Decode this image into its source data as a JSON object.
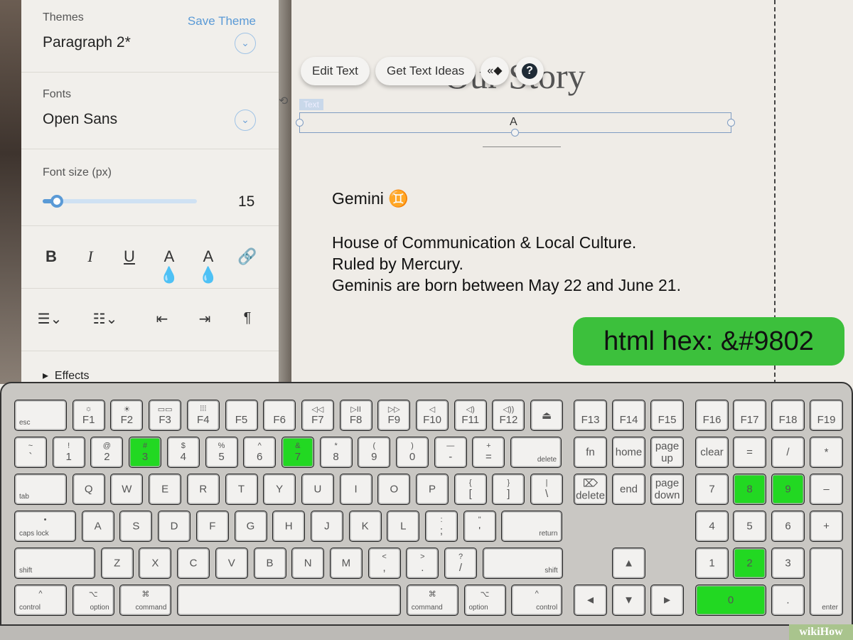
{
  "panel": {
    "themes_label": "Themes",
    "save_theme": "Save Theme",
    "theme_value": "Paragraph 2*",
    "fonts_label": "Fonts",
    "font_value": "Open Sans",
    "size_label": "Font size (px)",
    "size_value": "15",
    "size_fraction": 0.09,
    "effects": "Effects"
  },
  "toolbar": {
    "edit_text": "Edit Text",
    "get_text_ideas": "Get Text Ideas",
    "help": "?"
  },
  "canvas": {
    "title": "Our Story",
    "tag": "Text",
    "anchor": "A",
    "heading": "Gemini ♊",
    "line1": "House of Communication & Local Culture.",
    "line2": "Ruled by Mercury.",
    "line3": "Geminis are born between May 22 and June 21."
  },
  "badge": {
    "text": "html hex: &#9802",
    "color": "#3cc03c"
  },
  "highlight_color": "#22d822",
  "keyboard": {
    "rows": [
      [
        {
          "sl": "esc"
        },
        {
          "t": "☼",
          "b": "F1"
        },
        {
          "t": "☀",
          "b": "F2"
        },
        {
          "t": "▭▭",
          "b": "F3"
        },
        {
          "t": "⁞⁞⁞",
          "b": "F4"
        },
        {
          "b": "F5"
        },
        {
          "b": "F6"
        },
        {
          "t": "◁◁",
          "b": "F7"
        },
        {
          "t": "▷II",
          "b": "F8"
        },
        {
          "t": "▷▷",
          "b": "F9"
        },
        {
          "t": "◁",
          "b": "F10"
        },
        {
          "t": "◁)",
          "b": "F11"
        },
        {
          "t": "◁))",
          "b": "F12"
        },
        {
          "c": "⏏"
        }
      ],
      [
        {
          "t": "~",
          "b": "`"
        },
        {
          "t": "!",
          "b": "1"
        },
        {
          "t": "@",
          "b": "2"
        },
        {
          "t": "#",
          "b": "3",
          "hl": true
        },
        {
          "t": "$",
          "b": "4"
        },
        {
          "t": "%",
          "b": "5"
        },
        {
          "t": "^",
          "b": "6"
        },
        {
          "t": "&",
          "b": "7",
          "hl": true
        },
        {
          "t": "*",
          "b": "8"
        },
        {
          "t": "(",
          "b": "9"
        },
        {
          "t": ")",
          "b": "0"
        },
        {
          "t": "—",
          "b": "-"
        },
        {
          "t": "+",
          "b": "="
        },
        {
          "sr": "delete"
        }
      ],
      [
        {
          "sl": "tab"
        },
        {
          "c": "Q"
        },
        {
          "c": "W"
        },
        {
          "c": "E"
        },
        {
          "c": "R"
        },
        {
          "c": "T"
        },
        {
          "c": "Y"
        },
        {
          "c": "U"
        },
        {
          "c": "I"
        },
        {
          "c": "O"
        },
        {
          "c": "P"
        },
        {
          "t": "{",
          "b": "["
        },
        {
          "t": "}",
          "b": "]"
        },
        {
          "t": "|",
          "b": "\\"
        }
      ],
      [
        {
          "t": "•",
          "sl": "caps lock"
        },
        {
          "c": "A"
        },
        {
          "c": "S"
        },
        {
          "c": "D"
        },
        {
          "c": "F"
        },
        {
          "c": "G"
        },
        {
          "c": "H"
        },
        {
          "c": "J"
        },
        {
          "c": "K"
        },
        {
          "c": "L"
        },
        {
          "t": ":",
          "b": ";"
        },
        {
          "t": "\"",
          "b": "'"
        },
        {
          "sr": "return"
        }
      ],
      [
        {
          "sl": "shift"
        },
        {
          "c": "Z"
        },
        {
          "c": "X"
        },
        {
          "c": "C"
        },
        {
          "c": "V"
        },
        {
          "c": "B"
        },
        {
          "c": "N"
        },
        {
          "c": "M"
        },
        {
          "t": "<",
          "b": ","
        },
        {
          "t": ">",
          "b": "."
        },
        {
          "t": "?",
          "b": "/"
        },
        {
          "sr": "shift"
        }
      ],
      [
        {
          "t": "^",
          "sl": "control"
        },
        {
          "t": "⌥",
          "sr": "option"
        },
        {
          "t": "⌘",
          "sr": "command"
        },
        {},
        {
          "t": "⌘",
          "sl": "command"
        },
        {
          "t": "⌥",
          "sl": "option"
        },
        {
          "t": "^",
          "sr": "control"
        }
      ]
    ],
    "nav": [
      {
        "b": "F13"
      },
      {
        "b": "F14"
      },
      {
        "b": "F15"
      },
      {
        "c": "fn"
      },
      {
        "c": "home"
      },
      {
        "c": "page up"
      },
      {
        "c": "⌦ delete"
      },
      {
        "c": "end"
      },
      {
        "c": "page down"
      },
      {
        "c": "▲"
      },
      {
        "c": "◄"
      },
      {
        "c": "▼"
      },
      {
        "c": "►"
      }
    ],
    "numpad": [
      {
        "b": "F16"
      },
      {
        "b": "F17"
      },
      {
        "b": "F18"
      },
      {
        "b": "F19"
      },
      {
        "c": "clear"
      },
      {
        "c": "="
      },
      {
        "c": "/"
      },
      {
        "c": "*"
      },
      {
        "c": "7"
      },
      {
        "c": "8",
        "hl": true
      },
      {
        "c": "9",
        "hl": true
      },
      {
        "c": "–"
      },
      {
        "c": "4"
      },
      {
        "c": "5"
      },
      {
        "c": "6"
      },
      {
        "c": "+"
      },
      {
        "c": "1"
      },
      {
        "c": "2",
        "hl": true
      },
      {
        "c": "3"
      },
      {
        "sr": "enter"
      },
      {
        "c": "0",
        "hl": true
      },
      {
        "c": "."
      }
    ]
  },
  "watermark": "wikiHow"
}
